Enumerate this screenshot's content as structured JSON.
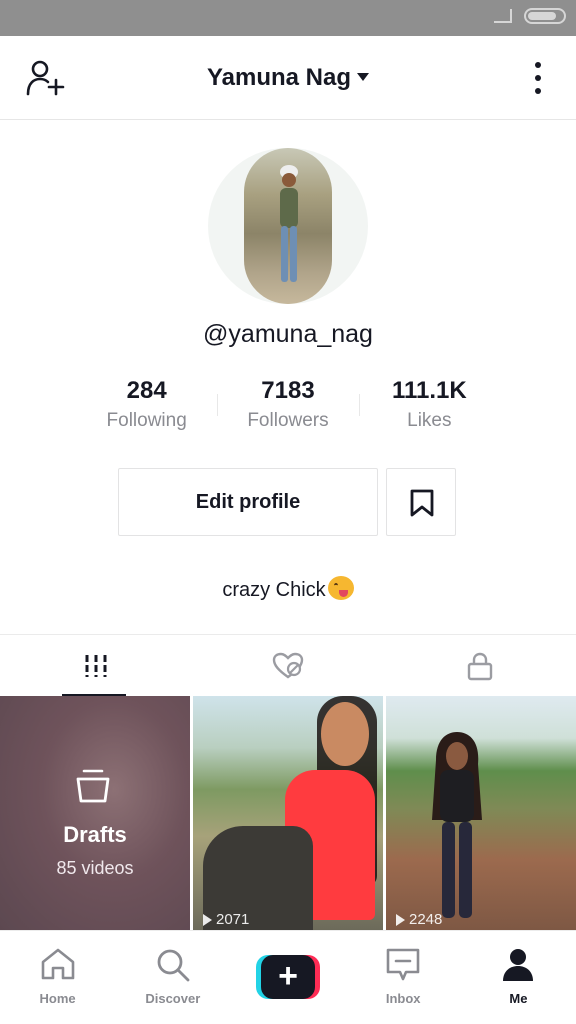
{
  "status_bar": {
    "carrier": "",
    "battery": ""
  },
  "header": {
    "title": "Yamuna Nag"
  },
  "profile": {
    "username": "@yamuna_nag",
    "bio": "crazy Chick"
  },
  "stats": [
    {
      "value": "284",
      "label": "Following"
    },
    {
      "value": "7183",
      "label": "Followers"
    },
    {
      "value": "111.1K",
      "label": "Likes"
    }
  ],
  "actions": {
    "edit_profile": "Edit profile"
  },
  "drafts": {
    "label": "Drafts",
    "count": "85 videos"
  },
  "videos": [
    {
      "views": "2071"
    },
    {
      "views": "2248"
    }
  ],
  "nav": [
    {
      "label": "Home"
    },
    {
      "label": "Discover"
    },
    {
      "label": "Inbox"
    },
    {
      "label": "Me"
    }
  ],
  "colors": {
    "accent_red": "#fe2c55",
    "accent_cyan": "#22d3e6",
    "text": "#161823",
    "muted": "#8a8b91"
  },
  "icons": [
    "add-user-icon",
    "caret-down-icon",
    "more-vertical-icon",
    "bookmark-icon",
    "grid-icon",
    "liked-hidden-icon",
    "lock-icon",
    "drafts-icon",
    "home-icon",
    "search-icon",
    "plus-icon",
    "inbox-icon",
    "person-icon"
  ]
}
